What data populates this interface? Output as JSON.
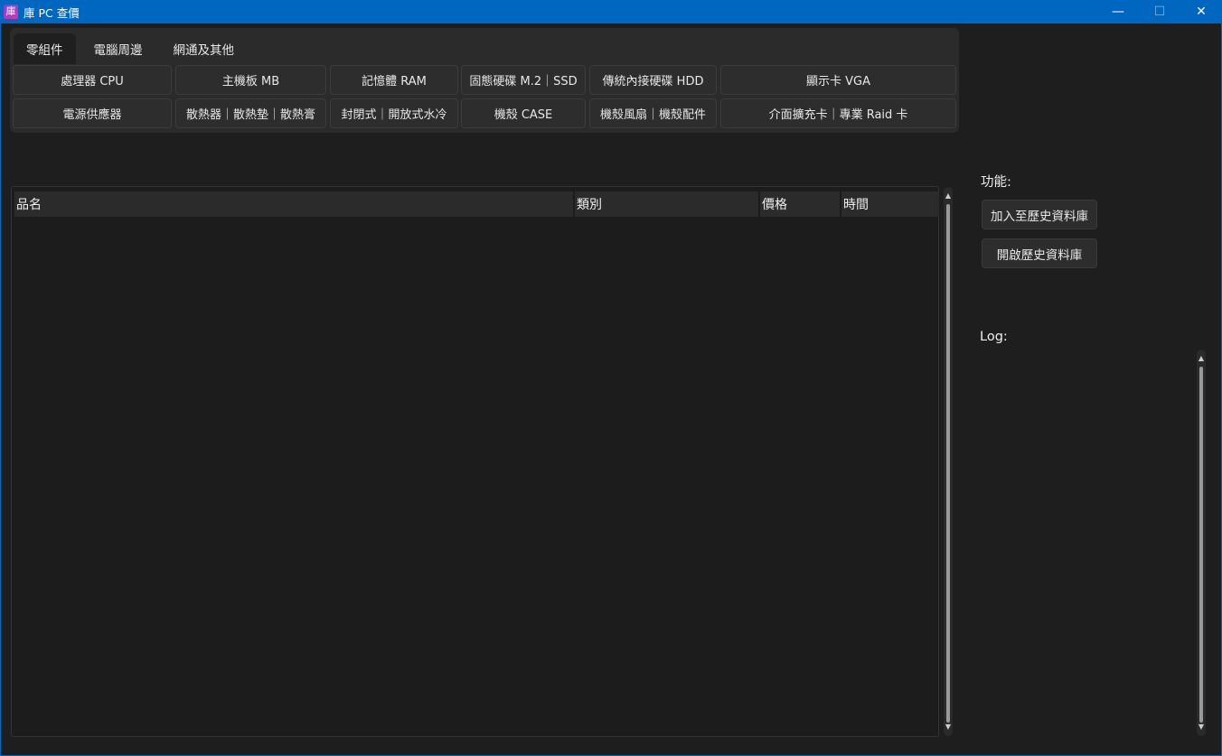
{
  "window": {
    "icon_glyph": "庫",
    "title": "庫 PC 查價",
    "minimize": "—",
    "maximize": "☐",
    "close": "✕"
  },
  "tabs": [
    {
      "label": "零組件",
      "active": true
    },
    {
      "label": "電腦周邊",
      "active": false
    },
    {
      "label": "網通及其他",
      "active": false
    }
  ],
  "categories": [
    [
      "處理器 CPU",
      "主機板 MB",
      "記憶體 RAM",
      "固態硬碟 M.2｜SSD",
      "傳統內接硬碟 HDD",
      "顯示卡 VGA"
    ],
    [
      "電源供應器",
      "散熱器｜散熱墊｜散熱膏",
      "封閉式｜開放式水冷",
      "機殼 CASE",
      "機殼風扇｜機殼配件",
      "介面擴充卡｜專業 Raid 卡"
    ]
  ],
  "table": {
    "columns": [
      "品名",
      "類別",
      "價格",
      "時間"
    ],
    "rows": []
  },
  "side": {
    "functions_label": "功能:",
    "add_history_button": "加入至歷史資料庫",
    "open_history_button": "開啟歷史資料庫",
    "log_label": "Log:"
  },
  "colors": {
    "titlebar": "#0067c0",
    "background": "#1e1e1e",
    "panel": "#2b2b2b"
  }
}
